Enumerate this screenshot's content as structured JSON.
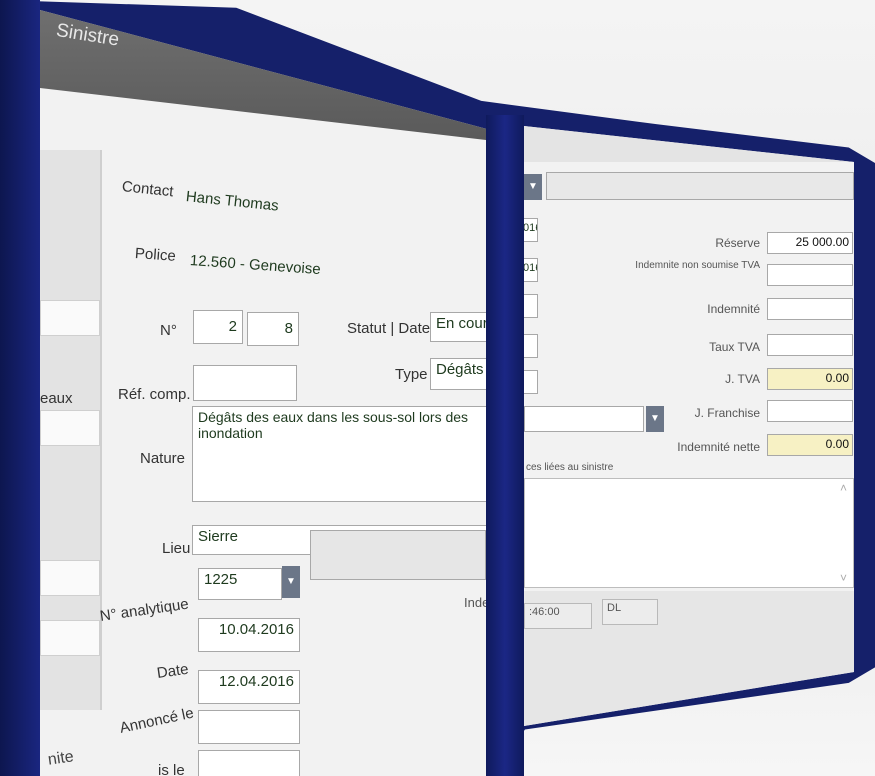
{
  "window": {
    "title": "Sinistre"
  },
  "form": {
    "contact_label": "Contact",
    "contact_value": "Hans Thomas",
    "police_label": "Police",
    "police_value": "12.560 - Genevoise",
    "numero_label": "N°",
    "numero_part1": "2",
    "numero_part2": "8",
    "statut_label": "Statut | Date",
    "statut_value": "En cours",
    "ref_label": "Réf. comp.",
    "ref_value": "",
    "type_label": "Type",
    "type_value": "Dégâts de",
    "nature_label": "Nature",
    "nature_value": "Dégâts des eaux dans les sous-sol lors des inondation",
    "lieu_label": "Lieu",
    "lieu_value": "Sierre",
    "analytique_label": "N° analytique",
    "analytique_value": "1225",
    "date_label": "Date",
    "date_value": "10.04.2016",
    "annonce_label": "Annoncé le",
    "annonce_value": "12.04.2016",
    "partial_label": "is le",
    "inde_fragment": "Inde",
    "left_fragment_eaux": "eaux",
    "left_fragment_nite": "nite"
  },
  "right": {
    "date_fragment_1": "016",
    "date_fragment_2": "016",
    "reserve_label": "Réserve",
    "reserve_value": "25 000.00",
    "indemnite_non_soumise_label": "Indemnite non soumise TVA",
    "indemnite_non_soumise_value": "",
    "indemnite_label": "Indemnité",
    "indemnite_value": "",
    "taux_tva_label": "Taux TVA",
    "taux_tva_value": "",
    "j_tva_label": "J. TVA",
    "j_tva_value": "0.00",
    "j_franchise_label": "J. Franchise",
    "j_franchise_value": "",
    "indemnite_nette_label": "Indemnité nette",
    "indemnite_nette_value": "0.00",
    "pieces_label": "ces liées au sinistre",
    "time_fragment": ":46:00",
    "user_value": "DL"
  },
  "icons": {
    "dropdown": "chevron-down-icon",
    "scroll_up": "chevron-up-icon",
    "scroll_down": "chevron-down-icon"
  },
  "colors": {
    "frame": "#15206a",
    "readonly_field": "#f7f1c4",
    "accent_dropdown": "#6b7688"
  }
}
